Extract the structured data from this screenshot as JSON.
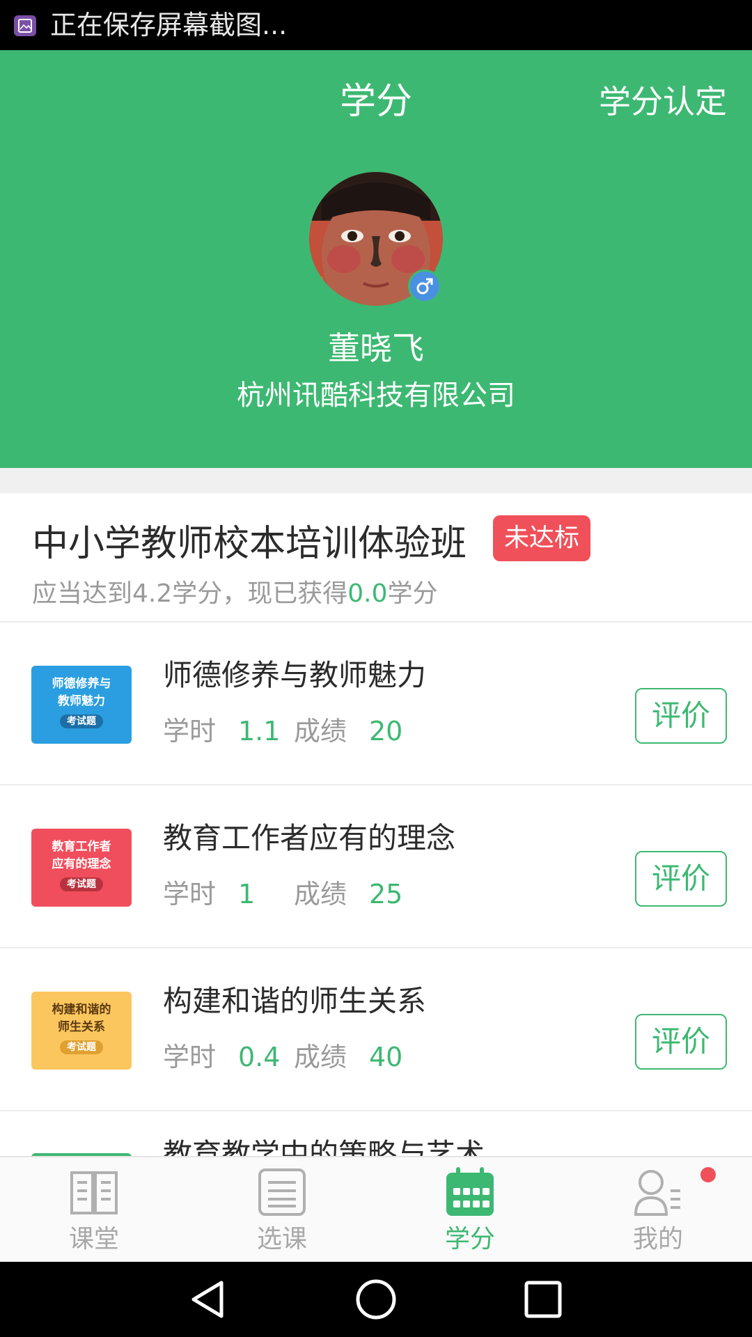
{
  "status_bar": {
    "text": "正在保存屏幕截图...",
    "icon": "screenshot-icon"
  },
  "header": {
    "title": "学分",
    "action": "学分认定"
  },
  "profile": {
    "name": "董晓飞",
    "company": "杭州讯酷科技有限公司",
    "gender_icon": "male-icon"
  },
  "class_info": {
    "title": "中小学教师校本培训体验班",
    "badge": "未达标",
    "requirement_prefix": "应当达到4.2学分，现已获得",
    "earned": "0.0",
    "requirement_suffix": "学分"
  },
  "courses": [
    {
      "thumb_line1": "师德修养与",
      "thumb_line2": "教师魅力",
      "thumb_tag": "考试题",
      "thumb_color": "#2a9ee0",
      "title": "师德修养与教师魅力",
      "hours_label": "学时",
      "hours": "1.1",
      "score_label": "成绩",
      "score": "20",
      "button": "评价"
    },
    {
      "thumb_line1": "教育工作者",
      "thumb_line2": "应有的理念",
      "thumb_tag": "考试题",
      "thumb_color": "#f04e5c",
      "title": "教育工作者应有的理念",
      "hours_label": "学时",
      "hours": "1",
      "score_label": "成绩",
      "score": "25",
      "button": "评价"
    },
    {
      "thumb_line1": "构建和谐的",
      "thumb_line2": "师生关系",
      "thumb_tag": "考试题",
      "thumb_color": "#fcc65e",
      "title": "构建和谐的师生关系",
      "hours_label": "学时",
      "hours": "0.4",
      "score_label": "成绩",
      "score": "40",
      "button": "评价"
    }
  ],
  "partial_course": {
    "title": "教育教学中的策略与艺术"
  },
  "tabs": [
    {
      "label": "课堂",
      "icon": "book-icon",
      "active": false
    },
    {
      "label": "选课",
      "icon": "list-icon",
      "active": false
    },
    {
      "label": "学分",
      "icon": "calendar-icon",
      "active": true
    },
    {
      "label": "我的",
      "icon": "user-icon",
      "active": false
    }
  ],
  "nav": {
    "back_icon": "back-triangle-icon",
    "home_icon": "home-circle-icon",
    "recents_icon": "recents-square-icon"
  },
  "colors": {
    "brand_green": "#3db872",
    "alert_red": "#f0505a",
    "gender_blue": "#4a90e2"
  }
}
